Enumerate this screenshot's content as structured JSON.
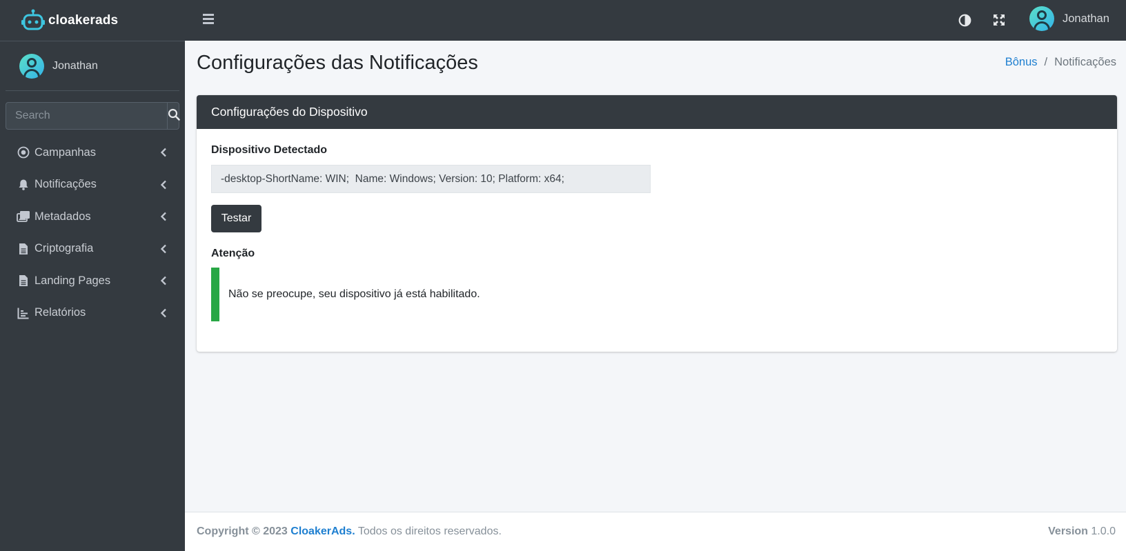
{
  "brand": {
    "name": "cloakerads"
  },
  "sidebar": {
    "user_name": "Jonathan",
    "search_placeholder": "Search",
    "items": [
      {
        "label": "Campanhas",
        "icon": "dot-circle-icon"
      },
      {
        "label": "Notificações",
        "icon": "bell-icon"
      },
      {
        "label": "Metadados",
        "icon": "images-icon"
      },
      {
        "label": "Criptografia",
        "icon": "file-icon"
      },
      {
        "label": "Landing Pages",
        "icon": "file-icon"
      },
      {
        "label": "Relatórios",
        "icon": "chart-icon"
      }
    ]
  },
  "topbar": {
    "user_name": "Jonathan"
  },
  "page": {
    "title": "Configurações das Notificações",
    "breadcrumb": {
      "link": "Bônus",
      "separator": "/",
      "current": "Notificações"
    }
  },
  "card": {
    "header": "Configurações do Dispositivo",
    "device_label": "Dispositivo Detectado",
    "device_value": "-desktop-ShortName: WIN;  Name: Windows; Version: 10; Platform: x64;",
    "test_button": "Testar",
    "attention_label": "Atenção",
    "callout_text": "Não se preocupe, seu dispositivo já está habilitado."
  },
  "footer": {
    "copyright_prefix": "Copyright © 2023",
    "brand_link": "CloakerAds.",
    "rights": "Todos os direitos reservados.",
    "version_label": "Version",
    "version_value": "1.0.0"
  },
  "colors": {
    "dark": "#343a40",
    "accent_link": "#1e7fd0",
    "success": "#28a745",
    "background": "#f4f6f9"
  }
}
